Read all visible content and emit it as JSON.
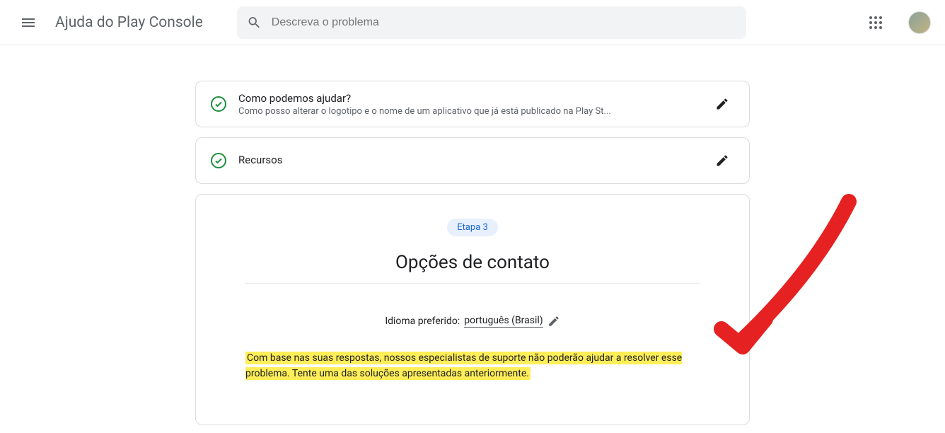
{
  "header": {
    "title": "Ajuda do Play Console",
    "search_placeholder": "Descreva o problema"
  },
  "steps": {
    "step1": {
      "title": "Como podemos ajudar?",
      "subtitle": "Como posso alterar o logotipo e o nome de um aplicativo que já está publicado na Play St..."
    },
    "step2": {
      "title": "Recursos"
    },
    "step3": {
      "pill": "Etapa 3",
      "heading": "Opções de contato",
      "lang_label": "Idioma preferido: ",
      "lang_value": "português (Brasil)",
      "message": "Com base nas suas respostas, nossos especialistas de suporte não poderão ajudar a resolver esse problema. Tente uma das soluções apresentadas anteriormente."
    }
  },
  "icons": {
    "menu": "menu-icon",
    "search": "search-icon",
    "apps": "apps-icon",
    "avatar": "avatar",
    "check": "check-circle-icon",
    "pencil": "pencil-icon"
  }
}
